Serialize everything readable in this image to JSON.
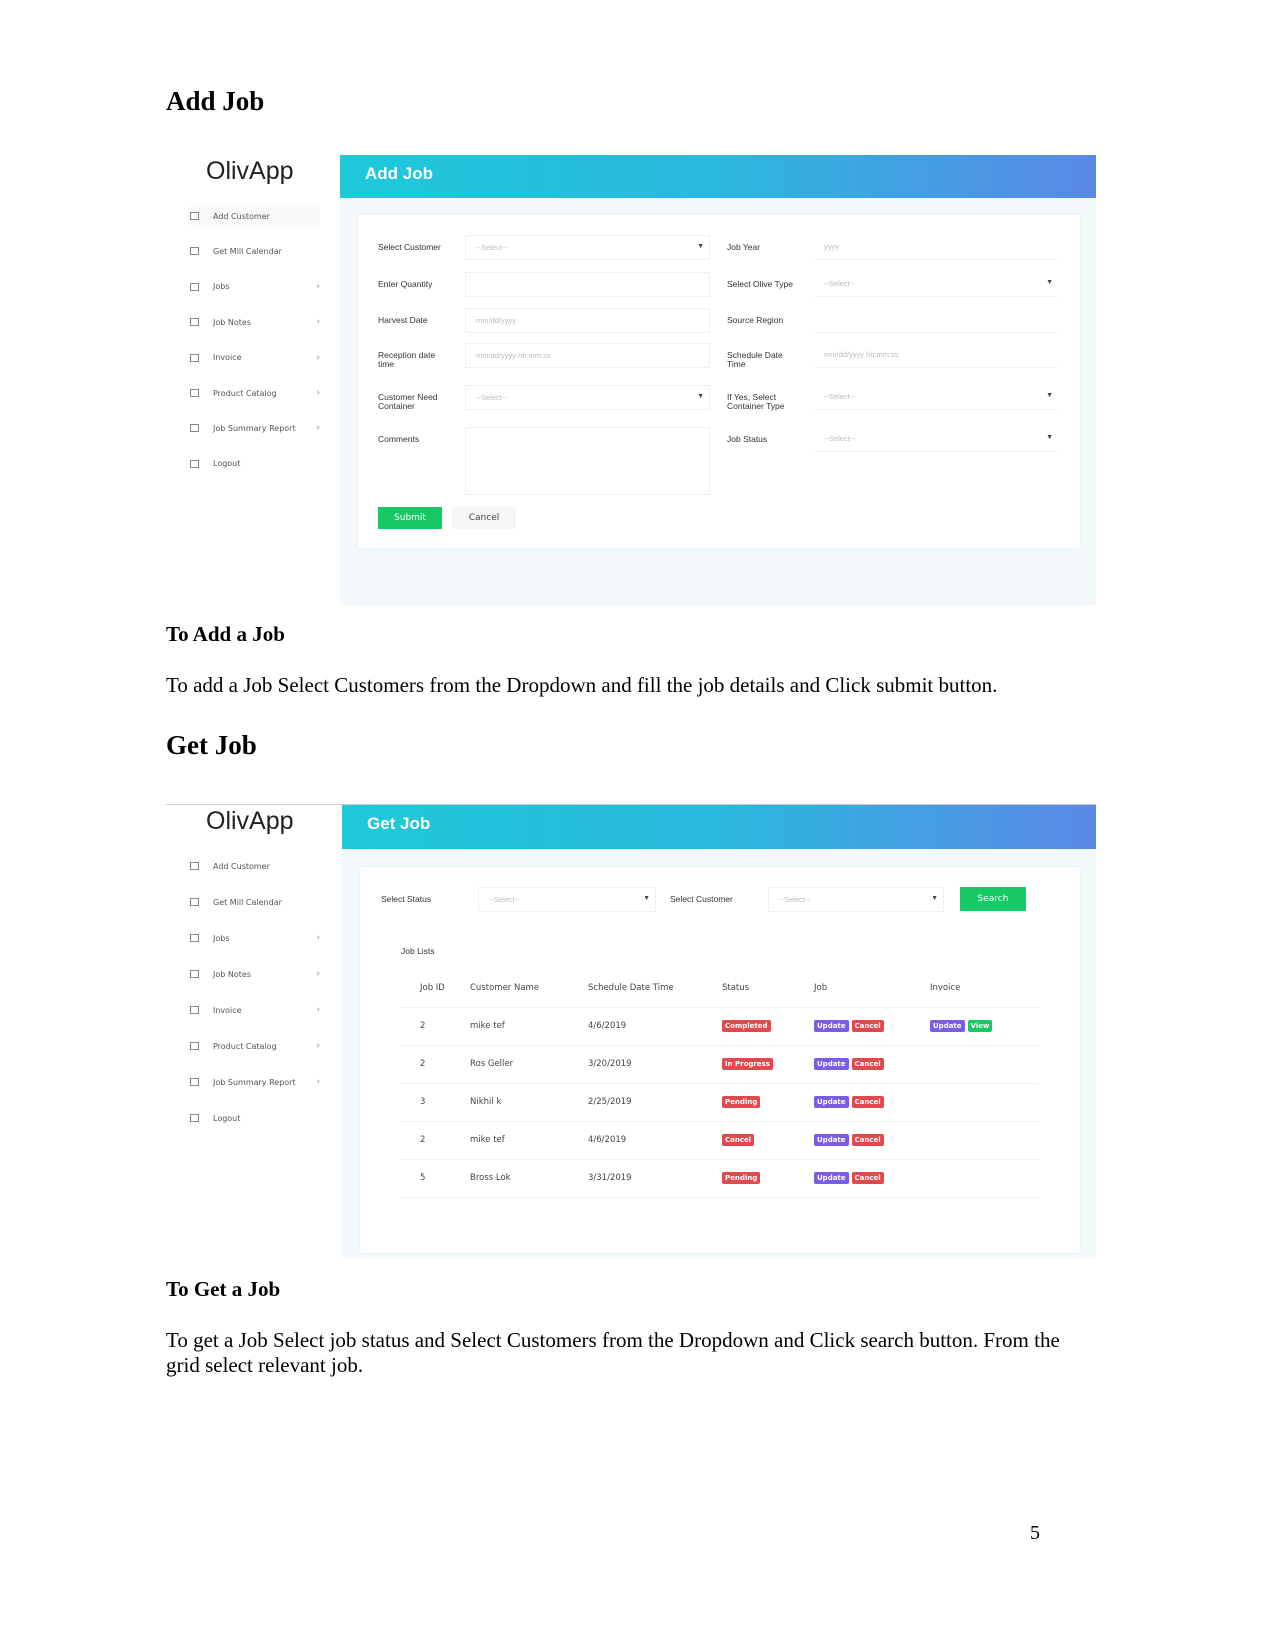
{
  "section1": {
    "heading": "Add Job",
    "subheading": "To Add a Job",
    "paragraph": "To add a Job Select Customers from the Dropdown and fill the job details and Click submit button."
  },
  "section2": {
    "heading": "Get Job",
    "subheading": "To Get a Job",
    "paragraph": "To get a Job Select job status and Select Customers from the Dropdown and Click search button. From the grid select relevant job."
  },
  "page_number": "5",
  "app": {
    "logo": "OlivApp",
    "nav": [
      {
        "label": "Add Customer",
        "icon": "monitor-icon",
        "chevron": false
      },
      {
        "label": "Get Mill Calendar",
        "icon": "monitor-icon",
        "chevron": false
      },
      {
        "label": "Jobs",
        "icon": "copy-icon",
        "chevron": true
      },
      {
        "label": "Job Notes",
        "icon": "copy-icon",
        "chevron": true
      },
      {
        "label": "Invoice",
        "icon": "copy-icon",
        "chevron": true
      },
      {
        "label": "Product Catalog",
        "icon": "copy-icon",
        "chevron": true
      },
      {
        "label": "Job Summary Report",
        "icon": "copy-icon",
        "chevron": true
      },
      {
        "label": "Logout",
        "icon": "logout-icon",
        "chevron": false
      }
    ],
    "colors": {
      "header_start": "#1ec9d9",
      "header_end": "#5a88e6",
      "green": "#17c964",
      "red": "#e04a4f",
      "purple": "#7c5ce0"
    }
  },
  "add_job": {
    "title": "Add Job",
    "left": [
      {
        "label": "Select Customer",
        "value": "--Select--",
        "select": true
      },
      {
        "label": "Enter Quantity",
        "value": "",
        "select": false
      },
      {
        "label": "Harvest Date",
        "value": "mm/dd/yyyy",
        "select": false
      },
      {
        "label": "Reception date time",
        "value": "mm/dd/yyyy hh:mm:ss",
        "select": false
      },
      {
        "label": "Customer Need Container",
        "value": "--Select--",
        "select": true
      },
      {
        "label": "Comments",
        "value": "",
        "select": false
      }
    ],
    "right": [
      {
        "label": "Job Year",
        "value": "yyyy",
        "select": false
      },
      {
        "label": "Select Olive Type",
        "value": "--Select--",
        "select": true
      },
      {
        "label": "Source Region",
        "value": "",
        "select": false
      },
      {
        "label": "Schedule Date Time",
        "value": "mm/dd/yyyy hh:mm:ss",
        "select": false
      },
      {
        "label": "If Yes, Select Container Type",
        "value": "--Select--",
        "select": true
      },
      {
        "label": "Job Status",
        "value": "--Select--",
        "select": true
      }
    ],
    "submit": "Submit",
    "cancel": "Cancel"
  },
  "get_job": {
    "title": "Get Job",
    "status_label": "Select Status",
    "status_value": "--Select--",
    "customer_label": "Select Customer",
    "customer_value": "--Select--",
    "search": "Search",
    "list_title": "Job Lists",
    "columns": [
      "Job ID",
      "Customer Name",
      "Schedule Date Time",
      "Status",
      "Job",
      "Invoice"
    ],
    "rows": [
      {
        "id": "2",
        "name": "mike tef",
        "date": "4/6/2019",
        "status": "Completed",
        "invoice": true
      },
      {
        "id": "2",
        "name": "Ros Geller",
        "date": "3/20/2019",
        "status": "In Progress",
        "invoice": false
      },
      {
        "id": "3",
        "name": "Nikhil k",
        "date": "2/25/2019",
        "status": "Pending",
        "invoice": false
      },
      {
        "id": "2",
        "name": "mike tef",
        "date": "4/6/2019",
        "status": "Cancel",
        "invoice": false
      },
      {
        "id": "5",
        "name": "Bross Lok",
        "date": "3/31/2019",
        "status": "Pending",
        "invoice": false
      }
    ],
    "update": "Update",
    "cancel": "Cancel",
    "view": "View"
  }
}
